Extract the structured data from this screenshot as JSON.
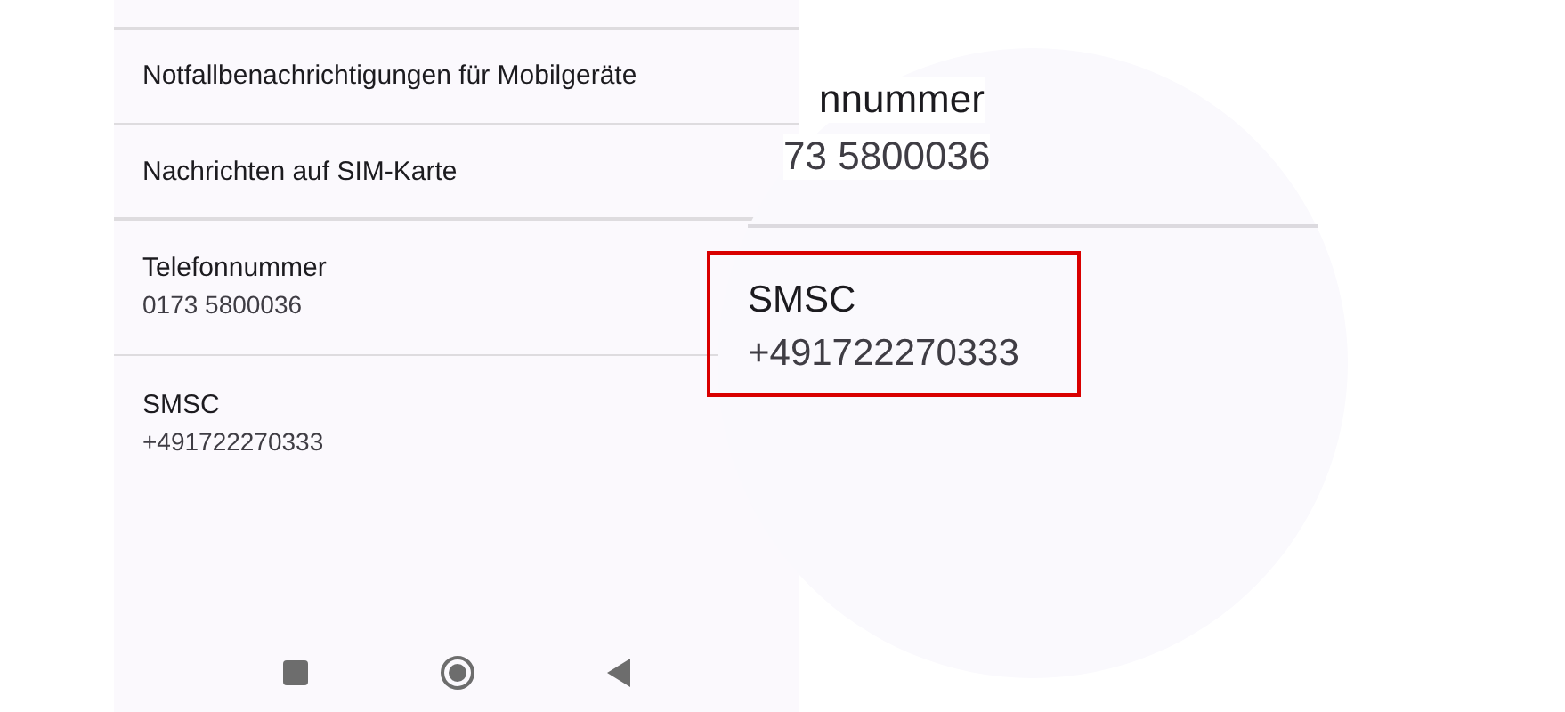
{
  "settings_list": [
    {
      "title": "Notfallbenachrichtigungen für Mobilgeräte"
    },
    {
      "title": "Nachrichten auf SIM-Karte"
    },
    {
      "title": "Telefonnummer",
      "subtitle": "0173 5800036"
    },
    {
      "title": "SMSC",
      "subtitle": "+491722270333"
    }
  ],
  "magnified": {
    "partial_title": "nnummer",
    "partial_subtitle": "73 5800036",
    "highlighted": {
      "title": "SMSC",
      "subtitle": "+491722270333"
    }
  }
}
